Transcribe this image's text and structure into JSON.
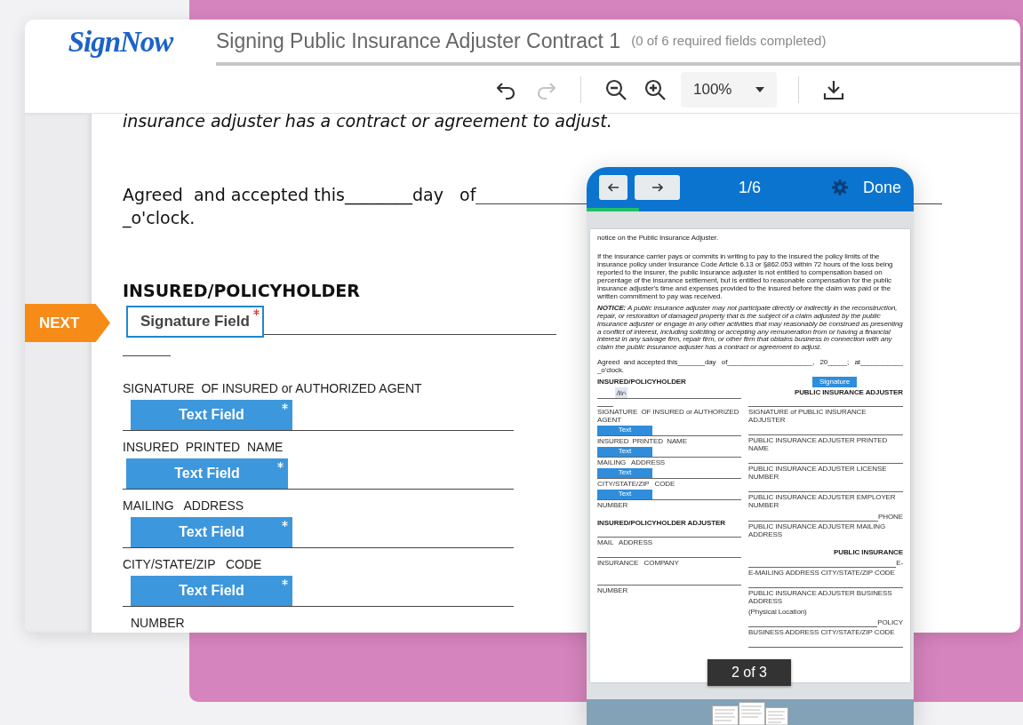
{
  "app": {
    "logo": "SignNow",
    "title": "Signing Public Insurance Adjuster Contract 1",
    "subtitle": "(0 of 6 required fields completed)"
  },
  "toolbar": {
    "tools": [
      {
        "kind": "undo",
        "disabled": false
      },
      {
        "kind": "redo",
        "disabled": true
      },
      {
        "kind": "divider"
      },
      {
        "kind": "zoom-out",
        "disabled": false
      },
      {
        "kind": "zoom-in",
        "disabled": false
      }
    ],
    "zoom": "100%"
  },
  "document": {
    "top_line": "insurance adjuster has a contract or agreement to adjust.",
    "agreed": "Agreed  and accepted this________day   of",
    "oclock": "_o'clock.",
    "heading": "INSURED/POLICYHOLDER",
    "next_tag": "NEXT",
    "signature_field": {
      "label": "Signature Field",
      "required": true,
      "selected": true
    },
    "fields": [
      {
        "label": "SIGNATURE  OF INSURED or AUTHORIZED AGENT",
        "field": "Text Field",
        "required": true
      },
      {
        "label": "INSURED  PRINTED  NAME",
        "field": "Text Field",
        "required": true
      },
      {
        "label": "MAILING   ADDRESS",
        "field": "Text Field",
        "required": true
      },
      {
        "label": "CITY/STATE/ZIP   CODE",
        "field": "Text Field",
        "required": true
      }
    ],
    "last_label": "NUMBER"
  },
  "mobile_preview": {
    "page_indicator": "1/6",
    "done": "Done",
    "level": 0.16,
    "page_badge": "2 of 3",
    "paragraphs": [
      {
        "kind": "plain",
        "text": "notice on the Public Insurance Adjuster."
      },
      {
        "kind": "plain",
        "text": "If the insurance carrier pays or commits in writing to pay to the insured the policy limits of the insurance policy under Insurance Code Article 6.13 or §862.053 within 72 hours of the loss being reported to the insurer, the public insurance adjuster is not entitled to compensation based on percentage of the insurance settlement, but is entitled to reasonable compensation for the public insurance adjuster's time and expenses provided to the insured before the claim was paid or the written commitment to pay was received."
      },
      {
        "kind": "notice",
        "text": "**NOTICE:** A public insurance adjuster may not participate directly or indirectly in the reconstruction, repair, or restoration of damaged property that is the subject of a claim adjusted by the public insurance adjuster or engage in any other activities that may reasonably be construed as presenting a conflict of interest, including soliciting or accepting any remuneration from or having a financial interest in any salvage firm, repair firm, or other firm that obtains business in connection with any claim the public insurance adjuster has a contract or agreement to adjust."
      }
    ],
    "agreed": "Agreed  and accepted this_______day   of______________________,   20_____;   at___________",
    "oclock": "_o'clock.",
    "left_column": [
      {
        "kind": "heading",
        "text": "INSURED/POLICYHOLDER"
      },
      {
        "kind": "signature"
      },
      {
        "kind": "short"
      },
      {
        "kind": "label",
        "text": "SIGNATURE  OF INSURED or AUTHORIZED AGENT"
      },
      {
        "kind": "field",
        "text": "Text"
      },
      {
        "kind": "label",
        "text": "INSURED  PRINTED  NAME"
      },
      {
        "kind": "field",
        "text": "Text"
      },
      {
        "kind": "label",
        "text": "MAILING   ADDRESS"
      },
      {
        "kind": "field",
        "text": "Text"
      },
      {
        "kind": "label",
        "text": "CITY/STATE/ZIP   CODE"
      },
      {
        "kind": "field",
        "text": "Text"
      },
      {
        "kind": "label",
        "text": "NUMBER"
      },
      {
        "kind": "gap"
      },
      {
        "kind": "heading",
        "text": "INSURED/POLICYHOLDER ADJUSTER"
      },
      {
        "kind": "line"
      },
      {
        "kind": "label",
        "text": "MAIL   ADDRESS"
      },
      {
        "kind": "line"
      },
      {
        "kind": "label",
        "text": "INSURANCE   COMPANY"
      },
      {
        "kind": "gap"
      },
      {
        "kind": "line"
      },
      {
        "kind": "label",
        "text": "NUMBER"
      }
    ],
    "right_column": [
      {
        "kind": "button",
        "text": "Signature"
      },
      {
        "kind": "heading",
        "text": "PUBLIC INSURANCE ADJUSTER"
      },
      {
        "kind": "line"
      },
      {
        "kind": "label",
        "text": "SIGNATURE of PUBLIC INSURANCE ADJUSTER"
      },
      {
        "kind": "line"
      },
      {
        "kind": "label",
        "text": "PUBLIC INSURANCE ADJUSTER PRINTED NAME"
      },
      {
        "kind": "line"
      },
      {
        "kind": "label",
        "text": "PUBLIC INSURANCE ADJUSTER LICENSE NUMBER"
      },
      {
        "kind": "line"
      },
      {
        "kind": "label",
        "text": "PUBLIC INSURANCE ADJUSTER EMPLOYER NUMBER"
      },
      {
        "kind": "line",
        "suffix": "PHONE"
      },
      {
        "kind": "label",
        "text": "PUBLIC INSURANCE ADJUSTER MAILING ADDRESS"
      },
      {
        "kind": "gap"
      },
      {
        "kind": "heading",
        "text": "PUBLIC INSURANCE"
      },
      {
        "kind": "line",
        "suffix": "E-"
      },
      {
        "kind": "label",
        "text": "E-MAILING ADDRESS CITY/STATE/ZIP CODE"
      },
      {
        "kind": "line"
      },
      {
        "kind": "label",
        "text": "PUBLIC INSURANCE ADJUSTER BUSINESS ADDRESS"
      },
      {
        "kind": "label",
        "text": "(Physical Location)"
      },
      {
        "kind": "line",
        "suffix": "POLICY"
      },
      {
        "kind": "label",
        "text": "BUSINESS ADDRESS CITY/STATE/ZIP CODE"
      },
      {
        "kind": "line"
      }
    ]
  }
}
